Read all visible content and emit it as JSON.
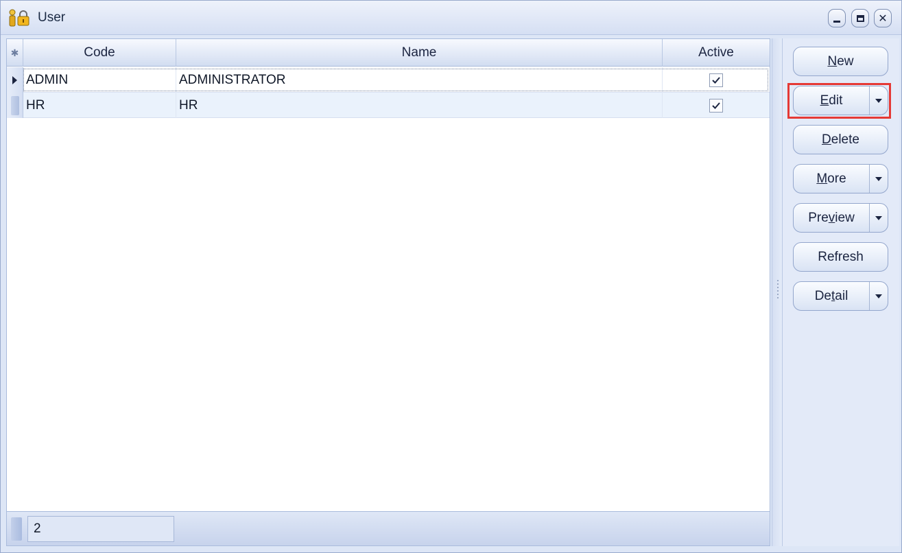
{
  "window": {
    "title": "User",
    "controls": [
      "minimize",
      "maximize",
      "close"
    ]
  },
  "grid": {
    "columns": [
      "Code",
      "Name",
      "Active"
    ],
    "rows": [
      {
        "code": "ADMIN",
        "name": "ADMINISTRATOR",
        "active": true
      },
      {
        "code": "HR",
        "name": "HR",
        "active": true
      }
    ],
    "record_count": "2"
  },
  "buttons": {
    "new": {
      "pre": "",
      "key": "N",
      "post": "ew"
    },
    "edit": {
      "pre": "",
      "key": "E",
      "post": "dit"
    },
    "delete": {
      "pre": "",
      "key": "D",
      "post": "elete"
    },
    "more": {
      "pre": "",
      "key": "M",
      "post": "ore"
    },
    "preview": {
      "pre": "Pre",
      "key": "v",
      "post": "iew"
    },
    "refresh": {
      "label": "Refresh"
    },
    "detail": {
      "pre": "De",
      "key": "t",
      "post": "ail"
    }
  },
  "colors": {
    "highlight": "#e53935",
    "alt_row": "#eaf2fc",
    "panel": "#e3eaf8"
  }
}
